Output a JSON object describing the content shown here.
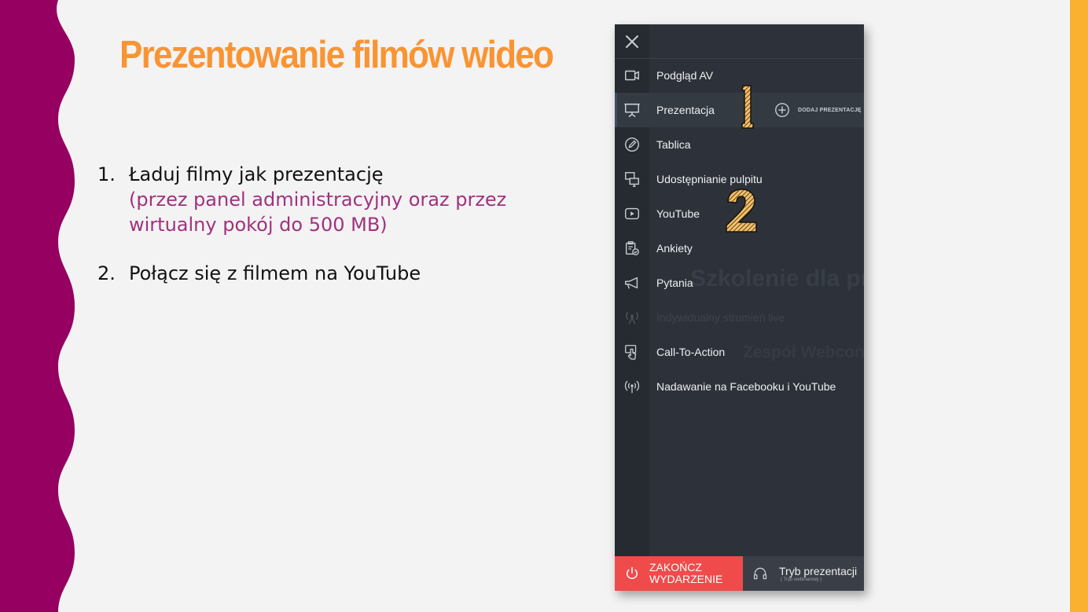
{
  "slide": {
    "title": "Prezentowanie filmów wideo",
    "steps": [
      {
        "num": "1.",
        "text": "Ładuj filmy jak prezentację",
        "note": "(przez panel administracyjny oraz przez wirtualny pokój do 500 MB)"
      },
      {
        "num": "2.",
        "text": "Połącz się z filmem na YouTube"
      }
    ],
    "markers": [
      "1",
      "2"
    ]
  },
  "panel": {
    "menu": [
      {
        "label": "Podgląd AV",
        "icon": "video-camera-icon"
      },
      {
        "label": "Prezentacja",
        "icon": "presentation-board-icon",
        "active": true
      },
      {
        "label": "Tablica",
        "icon": "pencil-icon"
      },
      {
        "label": "Udostępnianie pulpitu",
        "icon": "screen-share-icon"
      },
      {
        "label": "YouTube",
        "icon": "youtube-play-icon"
      },
      {
        "label": "Ankiety",
        "icon": "poll-clipboard-icon"
      },
      {
        "label": "Pytania",
        "icon": "megaphone-icon"
      },
      {
        "label": "Indywidualny strumień live",
        "icon": "antenna-icon",
        "disabled": true
      },
      {
        "label": "Call-To-Action",
        "icon": "hand-pointer-icon"
      },
      {
        "label": "Nadawanie na Facebooku i YouTube",
        "icon": "broadcast-icon"
      }
    ],
    "add_presentation": "DODAJ PREZENTACJĘ",
    "end_event": "ZAKOŃCZ WYDARZENIE",
    "mode": {
      "label": "Tryb prezentacji",
      "sub": "( Tryb webinarowy )"
    }
  },
  "background_ghost": {
    "event_title": "Szkolenie dla pr",
    "team": "Zespół Webcon"
  },
  "colors": {
    "title": "#f99433",
    "note": "#a0327e",
    "wave": "#960061",
    "right_stripe": "#fbb130",
    "panel": "#2d323a",
    "end_button": "#ef4b4b"
  }
}
